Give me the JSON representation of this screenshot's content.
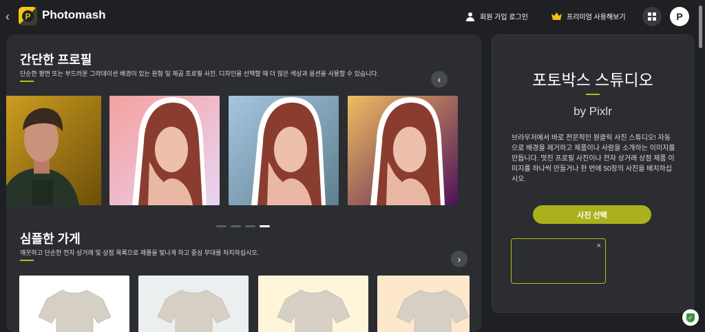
{
  "app": {
    "name": "Photomash"
  },
  "header": {
    "signup_login": "회원 가입 로그인",
    "premium": "프리미엄 사용해보기",
    "icons": [
      "back-icon",
      "user-icon",
      "crown-icon",
      "grid-icon",
      "pixlr-logo-icon"
    ]
  },
  "left": {
    "profile": {
      "title": "간단한 프로필",
      "description": "단순한 평면 또는 부드러운 그라데이션 배경이 있는 원형 및 제곱 프로필 사진. 디자인을 선택할 때 더 많은 색상과 옵션을 사용할 수 있습니다.",
      "cards": [
        "male-yellow",
        "female-pink",
        "female-blue",
        "female-gold-purple"
      ],
      "carousel": {
        "position": 4,
        "count": 4
      }
    },
    "store": {
      "title": "심플한 가게",
      "description": "깨끗하고 단순한 전자 상거래 및 상점 목록으로 제품을 빛나게 하고 중심 무대를 차지하십시오.",
      "cards": [
        "white-background",
        "light-gray-background",
        "cream-background",
        "peach-background"
      ]
    }
  },
  "right": {
    "title": "포토박스 스튜디오",
    "by": "by Pixlr",
    "description": "브라우저에서 바로 전문적인 원클릭 사진 스튜디오! 자동으로 배경을 제거하고 제품이나 사람을 소개하는 이미지를 만듭니다. 멋진 프로필 사진이나 전자 상거래 상점 제품 이미지를 하나씩 만들거나 한 번에 50장의 사진을 배치하십시오.",
    "select_button": "사진 선택",
    "close": "×"
  },
  "colors": {
    "background": "#1f2023",
    "panel": "#2b2d31",
    "accent": "#b6bf19",
    "button": "#aab11c"
  }
}
